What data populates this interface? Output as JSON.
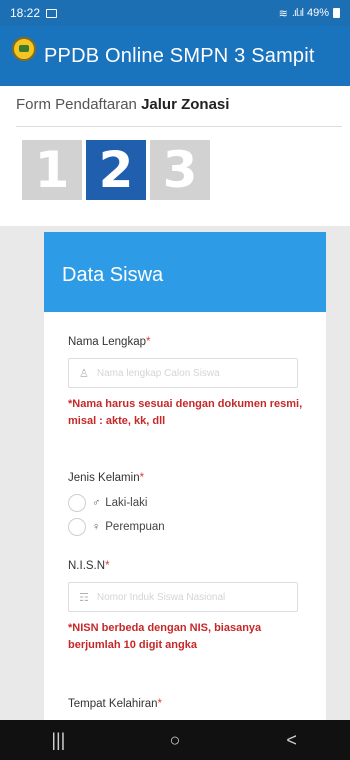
{
  "status_bar": {
    "time": "18:22",
    "battery": "49%"
  },
  "app_bar": {
    "title": "PPDB Online SMPN 3 Sampit"
  },
  "form": {
    "heading_prefix": "Form Pendaftaran",
    "heading_bold": "Jalur Zonasi",
    "steps": [
      "1",
      "2",
      "3"
    ],
    "active_step": 2
  },
  "card": {
    "title": "Data Siswa",
    "nama": {
      "label": "Nama Lengkap",
      "required": "*",
      "placeholder": "Nama lengkap Calon Siswa",
      "note": "*Nama harus sesuai dengan dokumen resmi, misal : akte, kk, dll"
    },
    "gender": {
      "label": "Jenis Kelamin",
      "required": "*",
      "options": [
        "Laki-laki",
        "Perempuan"
      ]
    },
    "nisn": {
      "label": "N.I.S.N",
      "required": "*",
      "placeholder": "Nomor Induk Siswa Nasional",
      "note": "*NISN berbeda dengan NIS, biasanya berjumlah 10 digit angka"
    },
    "tempat": {
      "label": "Tempat Kelahiran",
      "required": "*"
    }
  },
  "nav": {
    "recent": "|||",
    "home": "○",
    "back": "<"
  }
}
